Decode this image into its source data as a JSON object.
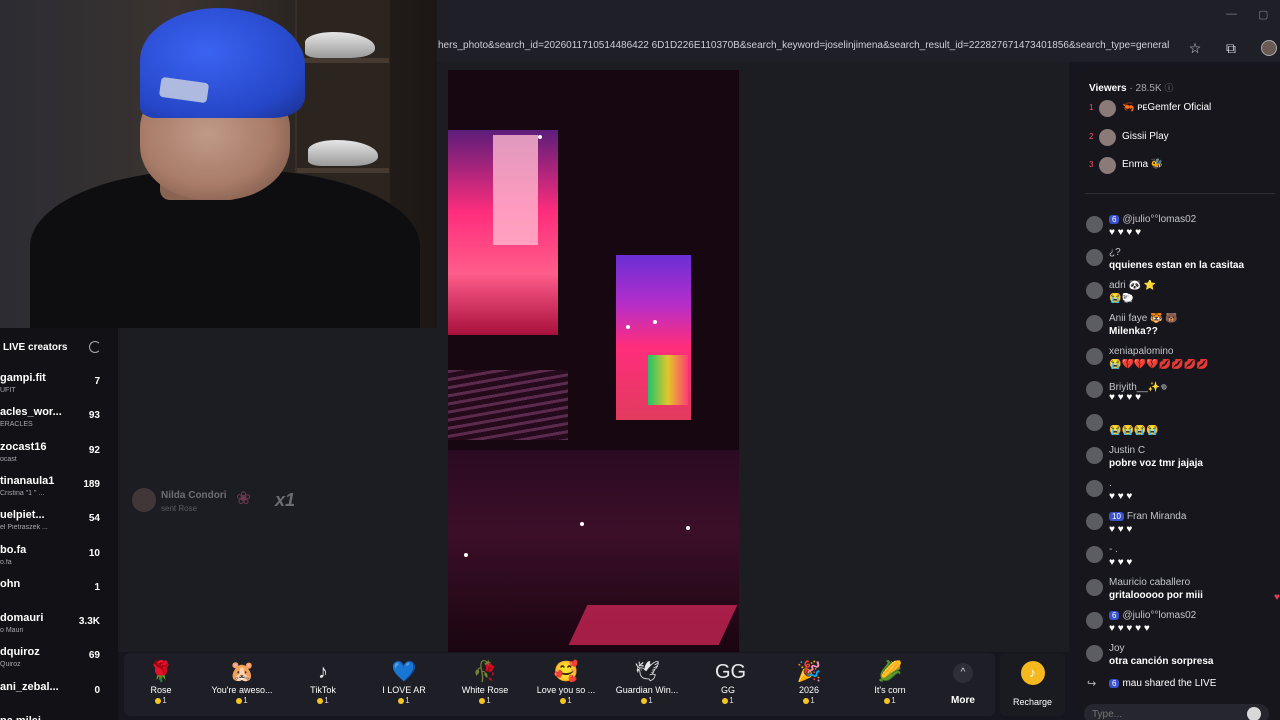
{
  "browser": {
    "url": "hers_photo&search_id=2026011710514486422 6D1D226E110370B&search_keyword=joselinjimena&search_result_id=222827671473401856&search_type=general",
    "minimize_glyph": "—",
    "restore_glyph": "▢"
  },
  "creators_panel": {
    "header": "LIVE creators",
    "items": [
      {
        "name": "gampi.fit",
        "sub": "UFIT",
        "count": "7"
      },
      {
        "name": "acles_wor...",
        "sub": "ERACLES",
        "count": "93"
      },
      {
        "name": "zocast16",
        "sub": "ocast",
        "count": "92"
      },
      {
        "name": "tinanaula1",
        "sub": "Cristina \"1 \" ...",
        "count": "189"
      },
      {
        "name": "uelpiet...",
        "sub": "el Pietraszek ...",
        "count": "54"
      },
      {
        "name": "bo.fa",
        "sub": "o.fa",
        "count": "10"
      },
      {
        "name": "ohn",
        "sub": "",
        "count": "1"
      },
      {
        "name": "domauri",
        "sub": "o Mauri",
        "count": "3.3K"
      },
      {
        "name": "dquiroz",
        "sub": "Quiroz",
        "count": "69"
      },
      {
        "name": "ani_zebal...",
        "sub": "",
        "count": "0"
      },
      {
        "name": "na.milei",
        "sub": "",
        "count": ""
      }
    ]
  },
  "gift_notice": {
    "name": "Nilda Condori",
    "action": "sent Rose",
    "multiplier": "x1"
  },
  "gifts": [
    {
      "name": "Rose",
      "price": "1",
      "icon": "rose-icon",
      "glyph": "🌹"
    },
    {
      "name": "You're aweso...",
      "price": "1",
      "icon": "hamster-icon",
      "glyph": "🐹"
    },
    {
      "name": "TikTok",
      "price": "1",
      "icon": "tiktok-icon",
      "glyph": "♪"
    },
    {
      "name": "I LOVE AR",
      "price": "1",
      "icon": "argentina-heart-icon",
      "glyph": "💙"
    },
    {
      "name": "White Rose",
      "price": "1",
      "icon": "white-rose-icon",
      "glyph": "🥀"
    },
    {
      "name": "Love you so ...",
      "price": "1",
      "icon": "hug-icon",
      "glyph": "🥰"
    },
    {
      "name": "Guardian Win...",
      "price": "1",
      "icon": "wing-icon",
      "glyph": "🕊"
    },
    {
      "name": "GG",
      "price": "1",
      "icon": "gg-icon",
      "glyph": "GG"
    },
    {
      "name": "2026",
      "price": "1",
      "icon": "year-icon",
      "glyph": "🎉"
    },
    {
      "name": "It's corn",
      "price": "1",
      "icon": "corn-icon",
      "glyph": "🌽"
    }
  ],
  "more_label": "More",
  "more_glyph": "^",
  "recharge_label": "Recharge",
  "recharge_glyph": "♪",
  "chat": {
    "viewers_label": "Viewers",
    "viewers_count": "· 28.5K",
    "ranking": [
      {
        "rank": "1",
        "name": "🦐 ᴘᴇGemfer Oficial"
      },
      {
        "rank": "2",
        "name": "Gissii    Play"
      },
      {
        "rank": "3",
        "name": "Enma 🐝"
      }
    ],
    "messages": [
      {
        "level": "6",
        "name": "@julio°°lomas02",
        "text": "♥ ♥ ♥ ♥"
      },
      {
        "level": "",
        "name": "¿?",
        "text": "qquienes estan en la casitaa"
      },
      {
        "level": "",
        "name": "adri 🐼 ⭐",
        "text": "😭🐑"
      },
      {
        "level": "",
        "name": "Anii faye 🐯 🐻",
        "text": "Milenka??"
      },
      {
        "level": "",
        "name": "xeniapalomino",
        "text": "😭💔💔💔💋💋💋💋"
      },
      {
        "level": "",
        "name": "Briyith__✨𖦹",
        "text": "♥ ♥ ♥ ♥"
      },
      {
        "level": "",
        "name": "",
        "text": "😭😭😭😭"
      },
      {
        "level": "",
        "name": "Justin C",
        "text": "pobre voz tmr jajaja"
      },
      {
        "level": "",
        "name": ".",
        "text": "♥ ♥ ♥"
      },
      {
        "level": "10",
        "name": "Fran Miranda",
        "text": "♥ ♥ ♥"
      },
      {
        "level": "",
        "name": "- .",
        "text": "♥ ♥ ♥"
      },
      {
        "level": "",
        "name": "Mauricio caballero",
        "text": "gritalooooo por miii"
      },
      {
        "level": "6",
        "name": "@julio°°lomas02",
        "text": "♥ ♥ ♥ ♥ ♥"
      },
      {
        "level": "",
        "name": "Joy",
        "text": "otra canción sorpresa"
      }
    ],
    "share": {
      "level": "6",
      "text": "mau  shared the LIVE"
    },
    "input_placeholder": "Type..."
  }
}
